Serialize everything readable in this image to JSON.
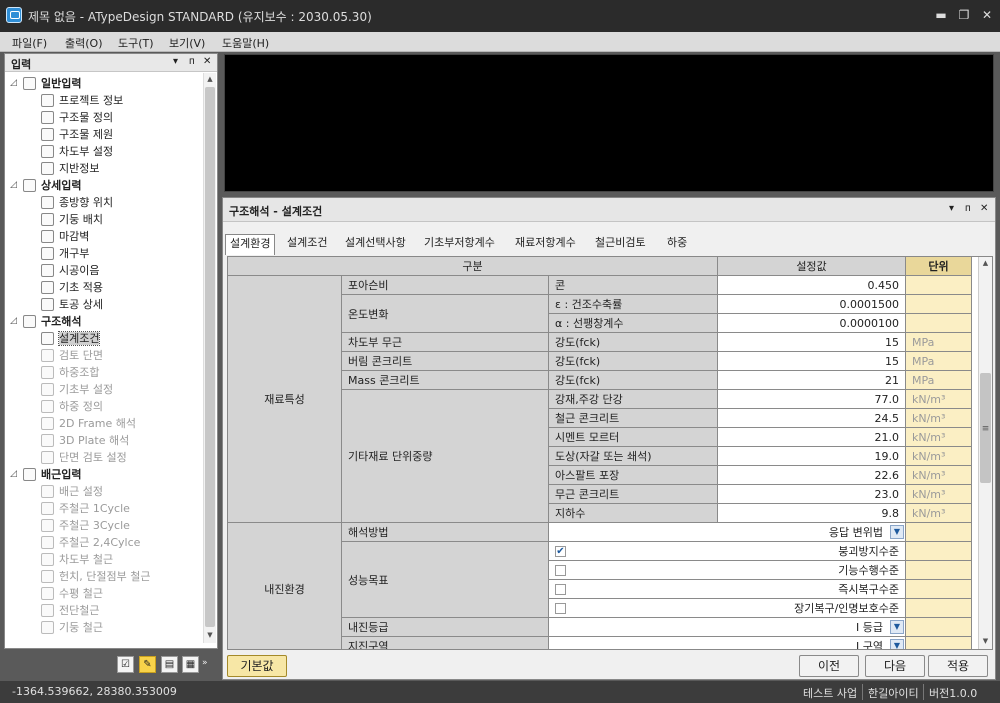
{
  "window": {
    "title": "제목 없음 - ATypeDesign STANDARD  (유지보수 : 2030.05.30)",
    "minimize": "▬",
    "restore": "❐",
    "close": "✕"
  },
  "menu": [
    "파일(F)",
    "출력(O)",
    "도구(T)",
    "보기(V)",
    "도움말(H)"
  ],
  "left_panel": {
    "title": "입력",
    "controls": [
      "▾",
      "ᴨ",
      "✕"
    ],
    "tree": [
      {
        "label": "일반입력",
        "group": true,
        "icon": "document-icon",
        "state": "normal"
      },
      {
        "label": "프로젝트 정보",
        "icon": "info-icon",
        "state": "normal"
      },
      {
        "label": "구조물 정의",
        "icon": "structure-icon",
        "state": "normal"
      },
      {
        "label": "구조물 제원",
        "icon": "dimension-icon",
        "state": "normal"
      },
      {
        "label": "차도부 설정",
        "icon": "road-icon",
        "state": "normal"
      },
      {
        "label": "지반정보",
        "icon": "ground-icon",
        "state": "normal"
      },
      {
        "label": "상세입력",
        "group": true,
        "icon": "monitor-icon",
        "state": "normal"
      },
      {
        "label": "종방향 위치",
        "icon": "axis-icon",
        "state": "normal"
      },
      {
        "label": "기둥 배치",
        "icon": "column-icon",
        "state": "normal"
      },
      {
        "label": "마감벽",
        "icon": "wall-icon",
        "state": "normal"
      },
      {
        "label": "개구부",
        "icon": "opening-icon",
        "state": "normal"
      },
      {
        "label": "시공이음",
        "icon": "joint-icon",
        "state": "normal"
      },
      {
        "label": "기초 적용",
        "icon": "foundation-icon",
        "state": "normal"
      },
      {
        "label": "토공 상세",
        "icon": "earthwork-icon",
        "state": "normal"
      },
      {
        "label": "구조해석",
        "group": true,
        "icon": "analysis-icon",
        "state": "normal"
      },
      {
        "label": "설계조건",
        "icon": "condition-icon",
        "state": "selected"
      },
      {
        "label": "검토 단면",
        "icon": "section-icon",
        "state": "disabled"
      },
      {
        "label": "하중조합",
        "icon": "load-combo-icon",
        "state": "disabled"
      },
      {
        "label": "기초부 설정",
        "icon": "foundation-setting-icon",
        "state": "disabled"
      },
      {
        "label": "하중 정의",
        "icon": "load-icon",
        "state": "disabled"
      },
      {
        "label": "2D Frame 해석",
        "icon": "frame-icon",
        "state": "disabled"
      },
      {
        "label": "3D Plate 해석",
        "icon": "plate-icon",
        "state": "disabled"
      },
      {
        "label": "단면 검토 설정",
        "icon": "section-check-icon",
        "state": "disabled"
      },
      {
        "label": "배근입력",
        "group": true,
        "icon": "rebar-icon",
        "state": "normal"
      },
      {
        "label": "배근 설정",
        "icon": "rebar-setting-icon",
        "state": "disabled"
      },
      {
        "label": "주철근 1Cycle",
        "icon": "rebar-cycle-icon",
        "state": "disabled"
      },
      {
        "label": "주철근 3Cycle",
        "icon": "rebar-cycle-icon",
        "state": "disabled"
      },
      {
        "label": "주철근 2,4Cylce",
        "icon": "rebar-cycle-icon",
        "state": "disabled"
      },
      {
        "label": "차도부 철근",
        "icon": "road-rebar-icon",
        "state": "disabled"
      },
      {
        "label": "헌치, 단절점부 철근",
        "icon": "haunch-icon",
        "state": "disabled"
      },
      {
        "label": "수평 철근",
        "icon": "horizontal-rebar-icon",
        "state": "disabled"
      },
      {
        "label": "전단철근",
        "icon": "shear-rebar-icon",
        "state": "disabled"
      },
      {
        "label": "기둥 철근",
        "icon": "column-rebar-icon",
        "state": "disabled"
      }
    ],
    "bottom_tools": [
      "☑",
      "✎",
      "▤",
      "▦"
    ],
    "more": "»"
  },
  "right_panel": {
    "title": "구조해석 - 설계조건",
    "controls": [
      "▾",
      "ᴨ",
      "✕"
    ],
    "tabs": [
      "설계환경",
      "설계조건",
      "설계선택사항",
      "기초부저항계수",
      "재료저항계수",
      "철근비검토",
      "하중"
    ],
    "active_tab": 0,
    "grid": {
      "headers": {
        "category": "구분",
        "value": "설정값",
        "unit": "단위"
      },
      "sections": [
        {
          "name": "재료특성",
          "subgroups": [
            {
              "name": "포아슨비",
              "rows": [
                {
                  "item": "콘",
                  "value": "0.450",
                  "unit": ""
                }
              ]
            },
            {
              "name": "온도변화",
              "rows": [
                {
                  "item": "ε : 건조수축률",
                  "value": "0.0001500",
                  "unit": ""
                },
                {
                  "item": "α : 선팽창계수",
                  "value": "0.0000100",
                  "unit": ""
                }
              ]
            },
            {
              "name": "차도부 무근",
              "rows": [
                {
                  "item": "강도(fck)",
                  "value": "15",
                  "unit": "MPa"
                }
              ]
            },
            {
              "name": "버림 콘크리트",
              "rows": [
                {
                  "item": "강도(fck)",
                  "value": "15",
                  "unit": "MPa"
                }
              ]
            },
            {
              "name": "Mass 콘크리트",
              "rows": [
                {
                  "item": "강도(fck)",
                  "value": "21",
                  "unit": "MPa"
                }
              ]
            },
            {
              "name": "기타재료 단위중량",
              "rows": [
                {
                  "item": "강재,주강 단강",
                  "value": "77.0",
                  "unit": "kN/m³"
                },
                {
                  "item": "철근 콘크리트",
                  "value": "24.5",
                  "unit": "kN/m³"
                },
                {
                  "item": "시멘트 모르터",
                  "value": "21.0",
                  "unit": "kN/m³"
                },
                {
                  "item": "도상(자갈 또는 쇄석)",
                  "value": "19.0",
                  "unit": "kN/m³"
                },
                {
                  "item": "아스팔트 포장",
                  "value": "22.6",
                  "unit": "kN/m³"
                },
                {
                  "item": "무근 콘크리트",
                  "value": "23.0",
                  "unit": "kN/m³"
                },
                {
                  "item": "지하수",
                  "value": "9.8",
                  "unit": "kN/m³"
                }
              ]
            }
          ]
        },
        {
          "name": "내진환경",
          "subgroups": [
            {
              "name": "해석방법",
              "rows": [
                {
                  "item": "",
                  "value": "응답 변위법",
                  "unit": "",
                  "dropdown": true
                }
              ]
            },
            {
              "name": "성능목표",
              "rows": [
                {
                  "item": "",
                  "value": "붕괴방지수준",
                  "checked": true
                },
                {
                  "item": "",
                  "value": "기능수행수준",
                  "checked": false
                },
                {
                  "item": "",
                  "value": "즉시복구수준",
                  "checked": false
                },
                {
                  "item": "",
                  "value": "장기복구/인명보호수준",
                  "checked": false
                }
              ]
            },
            {
              "name": "내진등급",
              "rows": [
                {
                  "item": "",
                  "value": "I 등급",
                  "unit": "",
                  "dropdown": true
                }
              ]
            },
            {
              "name": "지진구역",
              "rows": [
                {
                  "item": "",
                  "value": "I 구역",
                  "unit": "",
                  "dropdown": true
                }
              ]
            }
          ]
        }
      ],
      "scroll_up": "▲",
      "scroll_down": "▼",
      "scroll_grip": "≡"
    },
    "buttons": {
      "default": "기본값",
      "prev": "이전",
      "next": "다음",
      "apply": "적용"
    }
  },
  "status": {
    "coords": "-1364.539662,   28380.353009",
    "project": "테스트 사업",
    "company": "한길아이티",
    "version": "버전1.0.0"
  }
}
